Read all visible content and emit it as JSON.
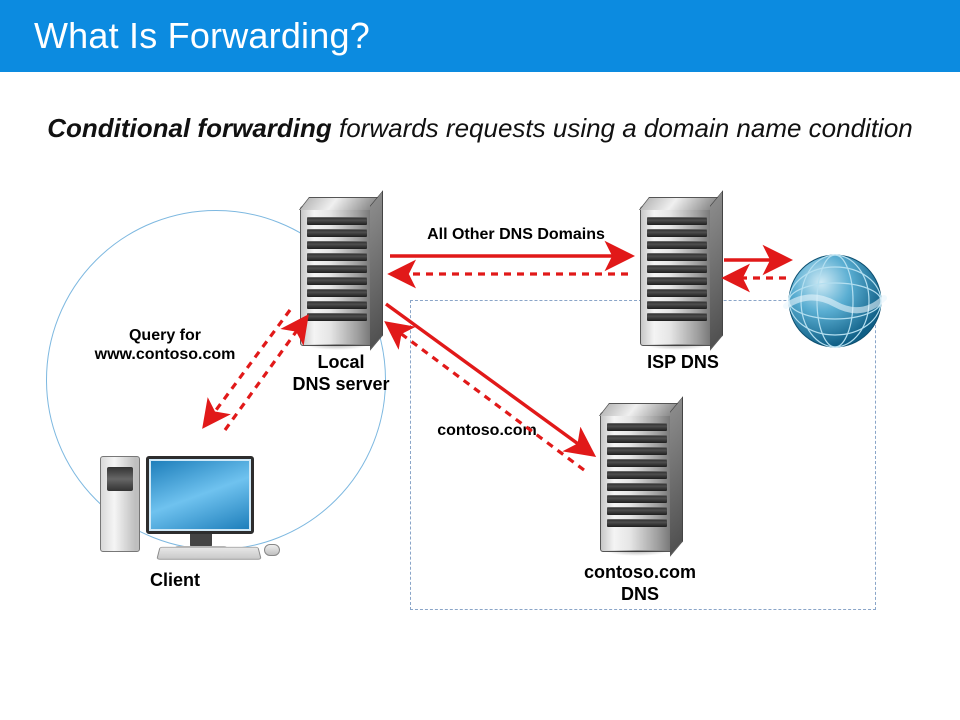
{
  "title": "What Is Forwarding?",
  "subtitle_bold": "Conditional forwarding",
  "subtitle_rest": " forwards requests using a domain name condition",
  "labels": {
    "query": "Query for\nwww.contoso.com",
    "local_dns": "Local\nDNS server",
    "isp_dns": "ISP DNS",
    "client": "Client",
    "all_other": "All Other DNS Domains",
    "contoso": "contoso.com",
    "contoso_dns": "contoso.com\nDNS"
  },
  "diagram": {
    "nodes": [
      {
        "id": "client",
        "type": "client-pc",
        "label_key": "client"
      },
      {
        "id": "local-dns",
        "type": "server",
        "label_key": "local_dns"
      },
      {
        "id": "isp-dns",
        "type": "server",
        "label_key": "isp_dns"
      },
      {
        "id": "contoso-dns",
        "type": "server",
        "label_key": "contoso_dns"
      },
      {
        "id": "internet",
        "type": "globe"
      }
    ],
    "edges": [
      {
        "from": "client",
        "to": "local-dns",
        "style": "dashed-both",
        "label_key": "query"
      },
      {
        "from": "local-dns",
        "to": "isp-dns",
        "style": "solid-dashed-pair",
        "label_key": "all_other"
      },
      {
        "from": "local-dns",
        "to": "contoso-dns",
        "style": "solid-dashed-pair",
        "label_key": "contoso"
      }
    ],
    "groups": [
      {
        "shape": "circle",
        "contains": [
          "client",
          "local-dns"
        ]
      },
      {
        "shape": "dashed-box",
        "contains": [
          "isp-dns",
          "contoso-dns"
        ]
      }
    ]
  },
  "colors": {
    "title_bg": "#0c8be0",
    "arrow": "#e11919",
    "circle": "#7db8e0",
    "box": "#8aa5c8"
  }
}
